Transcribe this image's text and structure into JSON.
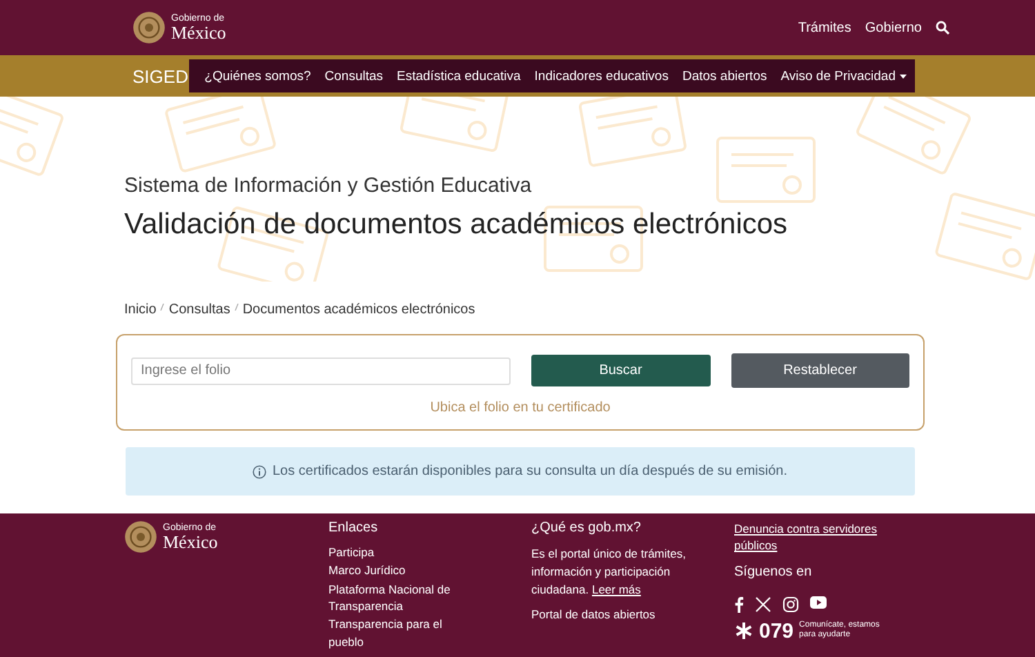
{
  "header": {
    "logo": {
      "line1": "Gobierno de",
      "line2": "México"
    },
    "links": [
      "Trámites",
      "Gobierno"
    ]
  },
  "nav": {
    "brand": "SIGED",
    "items": [
      {
        "label": "¿Quiénes somos?",
        "kind": "link"
      },
      {
        "label": "Consultas",
        "kind": "link"
      },
      {
        "label": "Estadística educativa",
        "kind": "link"
      },
      {
        "label": "Indicadores educativos",
        "kind": "link"
      },
      {
        "label": "Datos abiertos",
        "kind": "link"
      },
      {
        "label": "Aviso de Privacidad",
        "kind": "dropdown"
      }
    ]
  },
  "hero": {
    "subtitle": "Sistema de Información y Gestión Educativa",
    "title": "Validación de documentos académicos electrónicos"
  },
  "breadcrumb": [
    "Inicio",
    "Consultas",
    "Documentos académicos electrónicos"
  ],
  "search": {
    "placeholder": "Ingrese el folio",
    "buttons": [
      {
        "label": "Buscar",
        "kind": "primary"
      },
      {
        "label": "Restablecer",
        "kind": "secondary"
      }
    ],
    "hint": "Ubica el folio en tu certificado"
  },
  "info": {
    "text": "Los certificados estarán disponibles para su consulta un día después de su emisión."
  },
  "footer": {
    "logo": {
      "line1": "Gobierno de",
      "line2": "México"
    },
    "links": {
      "title": "Enlaces",
      "items": [
        "Participa",
        "Marco Jurídico",
        "Plataforma Nacional de Transparencia",
        "Transparencia para el pueblo"
      ]
    },
    "about": {
      "title": "¿Qué es gob.mx?",
      "text": "Es el portal único de trámites, información y participación ciudadana.",
      "link": "Leer más",
      "extra": "Portal de datos abiertos"
    },
    "report": "Denuncia contra servidores públicos",
    "follow": "Síguenos en",
    "hotline": {
      "number": "079",
      "text": "Comunícate, estamos para ayudarte"
    }
  }
}
